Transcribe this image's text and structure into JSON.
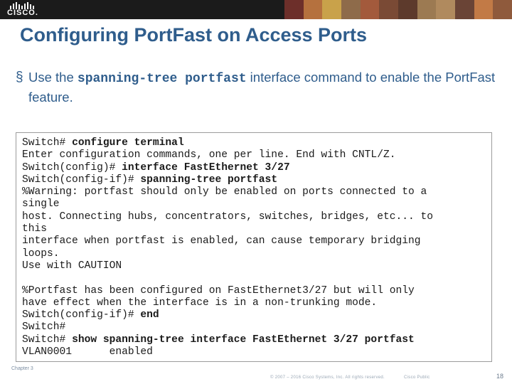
{
  "banner": {
    "logo_text": "CISCO.",
    "logo_icon": "cisco-bars-logo",
    "photo_colors": [
      "#6d2f2a",
      "#b5713e",
      "#c9a24a",
      "#8e6b4a",
      "#a35a3c",
      "#7a4a35",
      "#5d3a2c",
      "#9c7a52",
      "#b08a5e",
      "#6a4436",
      "#c27a46",
      "#8f5a3c"
    ]
  },
  "title": "Configuring PortFast on Access Ports",
  "bullet": {
    "marker": "§",
    "text_before": "Use the ",
    "command": "spanning-tree portfast",
    "text_after": " interface command to enable the PortFast feature."
  },
  "code": {
    "lines": [
      [
        {
          "t": "Switch# ",
          "b": false
        },
        {
          "t": "configure terminal",
          "b": true
        }
      ],
      [
        {
          "t": "Enter configuration commands, one per line. End with CNTL/Z.",
          "b": false
        }
      ],
      [
        {
          "t": "Switch(config)# ",
          "b": false
        },
        {
          "t": "interface FastEthernet 3/27",
          "b": true
        }
      ],
      [
        {
          "t": "Switch(config-if)# ",
          "b": false
        },
        {
          "t": "spanning-tree portfast",
          "b": true
        }
      ],
      [
        {
          "t": "%Warning: portfast should only be enabled on ports connected to a",
          "b": false
        }
      ],
      [
        {
          "t": "single",
          "b": false
        }
      ],
      [
        {
          "t": "host. Connecting hubs, concentrators, switches, bridges, etc... to",
          "b": false
        }
      ],
      [
        {
          "t": "this",
          "b": false
        }
      ],
      [
        {
          "t": "interface when portfast is enabled, can cause temporary bridging",
          "b": false
        }
      ],
      [
        {
          "t": "loops.",
          "b": false
        }
      ],
      [
        {
          "t": "Use with CAUTION",
          "b": false
        }
      ],
      [
        {
          "t": "",
          "b": false
        }
      ],
      [
        {
          "t": "%Portfast has been configured on FastEthernet3/27 but will only",
          "b": false
        }
      ],
      [
        {
          "t": "have effect when the interface is in a non-trunking mode.",
          "b": false
        }
      ],
      [
        {
          "t": "Switch(config-if)# ",
          "b": false
        },
        {
          "t": "end",
          "b": true
        }
      ],
      [
        {
          "t": "Switch#",
          "b": false
        }
      ],
      [
        {
          "t": "Switch# ",
          "b": false
        },
        {
          "t": "show spanning-tree interface FastEthernet 3/27 portfast",
          "b": true
        }
      ],
      [
        {
          "t": "VLAN0001      enabled",
          "b": false
        }
      ]
    ]
  },
  "footer": {
    "chapter": "Chapter 3",
    "copyright": "© 2007 – 2016  Cisco Systems, Inc. All rights reserved.",
    "classification": "Cisco Public",
    "page": "18"
  },
  "colors": {
    "title": "#2f5d8c",
    "banner": "#1b1b1b",
    "code_text": "#1a1a1a",
    "code_border": "#9c9c9c"
  }
}
